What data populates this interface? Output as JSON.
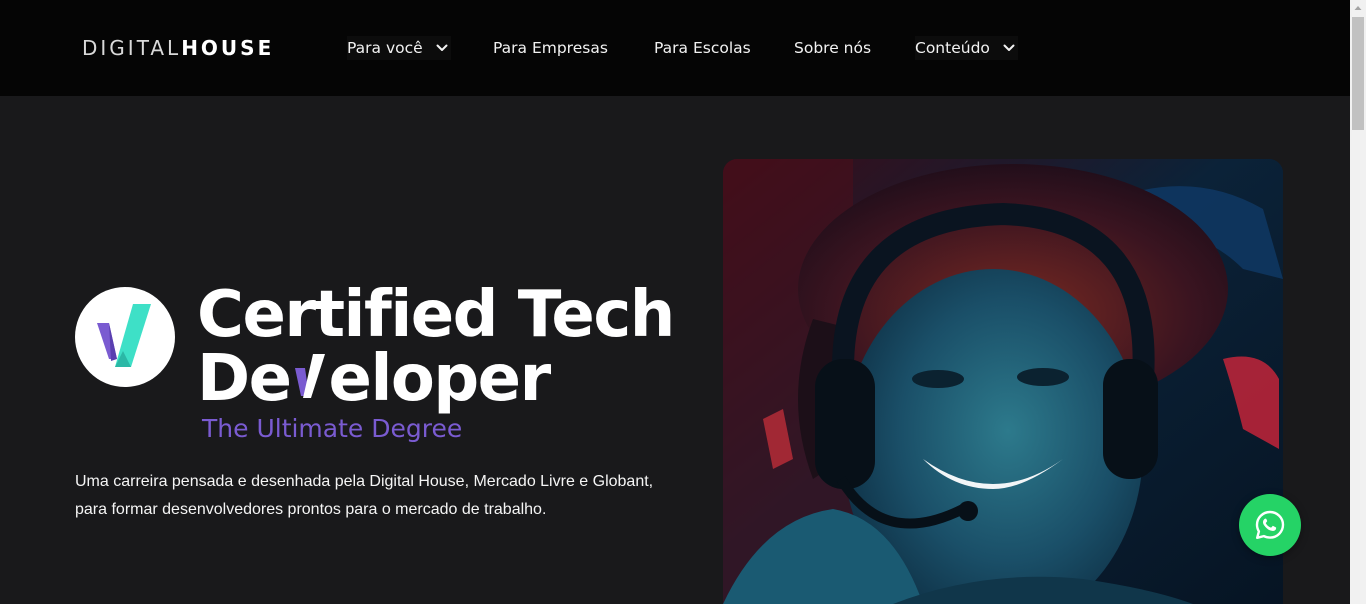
{
  "header": {
    "logo": {
      "light": "DIGITAL",
      "bold": "HOUSE"
    },
    "nav": [
      {
        "label": "Para você",
        "dropdown": true
      },
      {
        "label": "Para Empresas",
        "dropdown": false
      },
      {
        "label": "Para Escolas",
        "dropdown": false
      },
      {
        "label": "Sobre nós",
        "dropdown": false
      },
      {
        "label": "Conteúdo",
        "dropdown": true
      }
    ]
  },
  "hero": {
    "title_line1": "Certified Tech",
    "title_line2_a": "De",
    "title_line2_b": "eloper",
    "subtitle": "The Ultimate Degree",
    "description_line1": "Uma carreira pensada e desenhada pela Digital House, Mercado Livre e Globant,",
    "description_line2": "para formar desenvolvedores prontos para o mercado de trabalho."
  },
  "colors": {
    "accent_purple": "#7a5bd1",
    "accent_teal": "#3ee0c7",
    "whatsapp_green": "#25d366",
    "header_bg": "#050505",
    "page_bg": "#19191b"
  },
  "icons": {
    "chevron": "chevron-down-icon",
    "whatsapp": "whatsapp-icon",
    "badge": "certified-v-logo"
  }
}
